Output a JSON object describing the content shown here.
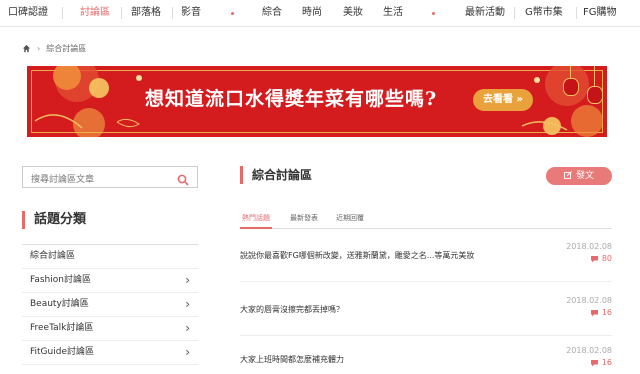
{
  "topnav": {
    "items": [
      {
        "label": "口碑認證",
        "active": false
      },
      {
        "label": "討論區",
        "active": true
      },
      {
        "label": "部落格",
        "active": false
      },
      {
        "label": "影音",
        "active": false
      },
      {
        "label": "綜合",
        "active": false
      },
      {
        "label": "時尚",
        "active": false
      },
      {
        "label": "美妝",
        "active": false
      },
      {
        "label": "生活",
        "active": false
      },
      {
        "label": "最新活動",
        "active": false
      },
      {
        "label": "G幣市集",
        "active": false
      },
      {
        "label": "FG購物",
        "active": false
      }
    ]
  },
  "breadcrumb": {
    "current": "綜合討論區"
  },
  "banner": {
    "headline": "想知道流口水得獎年菜有哪些嗎?",
    "cta": "去看看 »"
  },
  "search": {
    "placeholder": "搜尋討論區文章"
  },
  "sidebar": {
    "title": "話題分類",
    "items": [
      {
        "label": "綜合討論區",
        "chevron": false
      },
      {
        "label": "Fashion討論區",
        "chevron": true
      },
      {
        "label": "Beauty討論區",
        "chevron": true
      },
      {
        "label": "FreeTalk討論區",
        "chevron": true
      },
      {
        "label": "FitGuide討論區",
        "chevron": true
      }
    ]
  },
  "main": {
    "title": "綜合討論區",
    "post_button": "發文",
    "tabs": [
      {
        "label": "熱門話題",
        "active": true
      },
      {
        "label": "最新發表",
        "active": false
      },
      {
        "label": "近期回覆",
        "active": false
      }
    ],
    "threads": [
      {
        "title": "說說你最喜歡FG哪個新改變，送雅斯蘭黛，雕愛之名...等萬元美妝",
        "date": "2018.02.08",
        "count": "80"
      },
      {
        "title": "大家的唇膏沒擦完都丟掉嗎？",
        "date": "2018.02.08",
        "count": "16"
      },
      {
        "title": "大家上班時間都怎麼補充體力",
        "date": "2018.02.08",
        "count": "16"
      }
    ]
  },
  "colors": {
    "accent": "#e76a6a",
    "banner_red": "#d41c1f",
    "gold": "#e9b04a"
  }
}
